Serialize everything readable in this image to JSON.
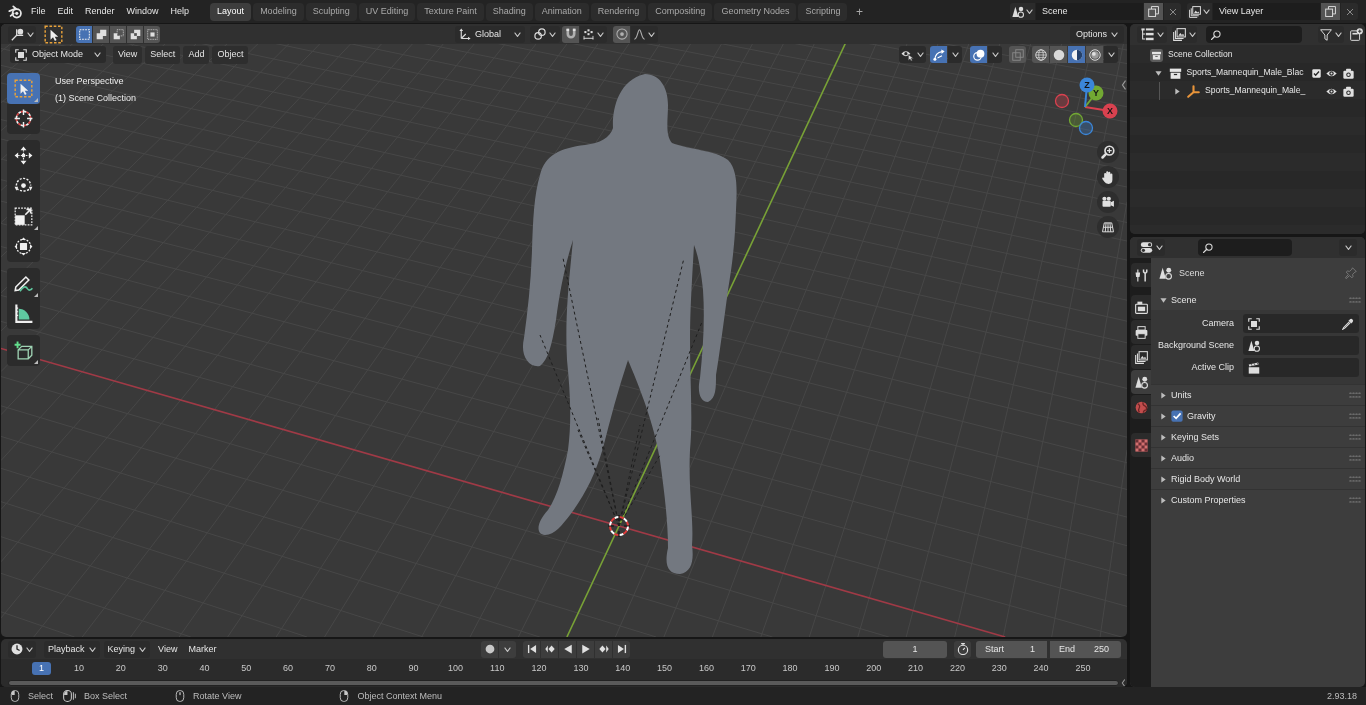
{
  "top_bar": {
    "menus": [
      "File",
      "Edit",
      "Render",
      "Window",
      "Help"
    ],
    "workspaces": [
      {
        "label": "Layout",
        "selected": true
      },
      {
        "label": "Modeling",
        "selected": false
      },
      {
        "label": "Sculpting",
        "selected": false
      },
      {
        "label": "UV Editing",
        "selected": false
      },
      {
        "label": "Texture Paint",
        "selected": false
      },
      {
        "label": "Shading",
        "selected": false
      },
      {
        "label": "Animation",
        "selected": false
      },
      {
        "label": "Rendering",
        "selected": false
      },
      {
        "label": "Compositing",
        "selected": false
      },
      {
        "label": "Geometry Nodes",
        "selected": false
      },
      {
        "label": "Scripting",
        "selected": false
      }
    ],
    "add_workspace": "+",
    "scene": "Scene",
    "view_layer": "View Layer"
  },
  "viewport": {
    "tool_settings": {
      "select_modes": [
        {
          "kind": "set",
          "selected": true
        },
        {
          "kind": "extend",
          "selected": false
        },
        {
          "kind": "subtract",
          "selected": false
        },
        {
          "kind": "difference",
          "selected": false
        },
        {
          "kind": "intersect",
          "selected": false
        }
      ],
      "orientation": "Global",
      "toggles": [
        {
          "kind": "snap",
          "on": false
        },
        {
          "kind": "proportional",
          "on": false
        }
      ],
      "options": "Options"
    },
    "header": {
      "mode": "Object Mode",
      "menus": [
        "View",
        "Select",
        "Add",
        "Object"
      ],
      "toggles": [
        {
          "kind": "gizmos",
          "on": true
        },
        {
          "kind": "overlays",
          "on": true
        },
        {
          "kind": "xray",
          "on": false
        }
      ],
      "shading": [
        {
          "kind": "wireframe",
          "selected": false
        },
        {
          "kind": "solid",
          "selected": false
        },
        {
          "kind": "material",
          "selected": true
        },
        {
          "kind": "rendered",
          "selected": false
        }
      ]
    },
    "info": [
      "User Perspective",
      "(1) Scene Collection"
    ],
    "tool_groups": [
      {
        "tools": [
          {
            "kind": "select_box",
            "selected": true,
            "variants": true
          },
          {
            "kind": "cursor",
            "selected": false,
            "variants": false
          }
        ]
      },
      {
        "tools": [
          {
            "kind": "move",
            "selected": false,
            "variants": false
          },
          {
            "kind": "rotate",
            "selected": false,
            "variants": false
          },
          {
            "kind": "scale",
            "selected": false,
            "variants": true
          },
          {
            "kind": "transform",
            "selected": false,
            "variants": false
          }
        ]
      },
      {
        "tools": [
          {
            "kind": "annotate",
            "selected": false,
            "variants": true
          },
          {
            "kind": "measure",
            "selected": false,
            "variants": false
          }
        ]
      },
      {
        "tools": [
          {
            "kind": "add_cube",
            "selected": false,
            "variants": true
          }
        ]
      }
    ],
    "gizmo_axes": [
      {
        "label": "X",
        "color": "#d9414f"
      },
      {
        "label": "Y",
        "color": "#72a833"
      },
      {
        "label": "Z",
        "color": "#3b86d8"
      }
    ],
    "navigation": [
      {
        "kind": "zoom"
      },
      {
        "kind": "pan"
      },
      {
        "kind": "camera"
      },
      {
        "kind": "ortho"
      }
    ]
  },
  "timeline": {
    "menus": [
      {
        "label": "Playback",
        "dropdown": true
      },
      {
        "label": "Keying",
        "dropdown": true
      },
      {
        "label": "View",
        "dropdown": false
      },
      {
        "label": "Marker",
        "dropdown": false
      }
    ],
    "auto_keying": false,
    "transport": [
      {
        "kind": "jump_start"
      },
      {
        "kind": "prev_key"
      },
      {
        "kind": "play_reverse"
      },
      {
        "kind": "play"
      },
      {
        "kind": "next_key"
      },
      {
        "kind": "jump_end"
      }
    ],
    "current_frame": "1",
    "preview_range": false,
    "start": {
      "label": "Start",
      "value": "1"
    },
    "end": {
      "label": "End",
      "value": "250"
    },
    "ruler": {
      "current": "1",
      "labels": [
        "10",
        "20",
        "30",
        "40",
        "50",
        "60",
        "70",
        "80",
        "90",
        "100",
        "110",
        "120",
        "130",
        "140",
        "150",
        "160",
        "170",
        "180",
        "190",
        "200",
        "210",
        "220",
        "230",
        "240",
        "250"
      ]
    }
  },
  "outliner": {
    "tree": [
      {
        "label": "Scene Collection",
        "kind": "scene_collection",
        "children": [
          {
            "label": "Sports_Mannequin_Male_Blac",
            "kind": "collection",
            "expanded": true,
            "included": true,
            "visible": true,
            "renderable": true,
            "children": [
              {
                "label": "Sports_Mannequin_Male_",
                "kind": "armature",
                "expanded": false,
                "visible": true,
                "renderable": true
              }
            ]
          }
        ]
      }
    ]
  },
  "properties": {
    "tab_groups": [
      {
        "tabs": [
          {
            "kind": "tool",
            "selected": false
          }
        ]
      },
      {
        "tabs": [
          {
            "kind": "render",
            "selected": false
          },
          {
            "kind": "output",
            "selected": false
          },
          {
            "kind": "view_layer",
            "selected": false
          },
          {
            "kind": "scene",
            "selected": true
          },
          {
            "kind": "world",
            "selected": false
          }
        ]
      },
      {
        "tabs": [
          {
            "kind": "texture",
            "selected": false
          }
        ]
      }
    ],
    "context": "Scene",
    "panels": [
      {
        "title": "Scene",
        "expanded": true,
        "fields": [
          {
            "label": "Camera",
            "kind": "camera"
          },
          {
            "label": "Background Scene",
            "kind": "scene"
          },
          {
            "label": "Active Clip",
            "kind": "clip"
          }
        ]
      },
      {
        "title": "Units",
        "expanded": false
      },
      {
        "title": "Gravity",
        "expanded": false,
        "checked": true
      },
      {
        "title": "Keying Sets",
        "expanded": false
      },
      {
        "title": "Audio",
        "expanded": false
      },
      {
        "title": "Rigid Body World",
        "expanded": false
      },
      {
        "title": "Custom Properties",
        "expanded": false
      }
    ]
  },
  "status_bar": {
    "hints": [
      {
        "kind": "left_click",
        "label": "Select"
      },
      {
        "kind": "left_drag",
        "label": "Box Select"
      },
      {
        "kind": "middle_drag",
        "label": "Rotate View"
      },
      {
        "kind": "right_click",
        "label": "Object Context Menu"
      }
    ],
    "version": "2.93.18"
  }
}
